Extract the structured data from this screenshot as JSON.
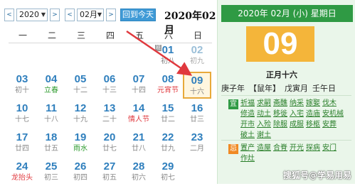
{
  "toolbar": {
    "year": "2020",
    "month": "02月",
    "prev": "<",
    "next": ">",
    "dropdown": "▼",
    "today_label": "回到今天"
  },
  "title": "2020年02月",
  "weekdays": [
    "一",
    "二",
    "三",
    "四",
    "五",
    "六",
    "日"
  ],
  "weeks": [
    [
      {
        "d": "",
        "l": ""
      },
      {
        "d": "",
        "l": ""
      },
      {
        "d": "",
        "l": ""
      },
      {
        "d": "",
        "l": ""
      },
      {
        "d": "",
        "l": ""
      },
      {
        "d": "01",
        "l": "初八",
        "ban": "班"
      },
      {
        "d": "02",
        "l": "初九",
        "dim": true
      }
    ],
    [
      {
        "d": "03",
        "l": "初十"
      },
      {
        "d": "04",
        "l": "立春",
        "c": "green"
      },
      {
        "d": "05",
        "l": "十二"
      },
      {
        "d": "06",
        "l": "十三"
      },
      {
        "d": "07",
        "l": "十四"
      },
      {
        "d": "08",
        "l": "元宵节",
        "c": "red"
      },
      {
        "d": "09",
        "l": "十六",
        "selected": true
      }
    ],
    [
      {
        "d": "10",
        "l": "十七"
      },
      {
        "d": "11",
        "l": "十八"
      },
      {
        "d": "12",
        "l": "十九"
      },
      {
        "d": "13",
        "l": "二十"
      },
      {
        "d": "14",
        "l": "情人节",
        "c": "red"
      },
      {
        "d": "15",
        "l": "廿二"
      },
      {
        "d": "16",
        "l": "廿三"
      }
    ],
    [
      {
        "d": "17",
        "l": "廿四"
      },
      {
        "d": "18",
        "l": "廿五"
      },
      {
        "d": "19",
        "l": "雨水",
        "c": "green"
      },
      {
        "d": "20",
        "l": "廿七"
      },
      {
        "d": "21",
        "l": "廿八"
      },
      {
        "d": "22",
        "l": "廿九"
      },
      {
        "d": "23",
        "l": "二月"
      }
    ],
    [
      {
        "d": "24",
        "l": "龙抬头",
        "c": "red"
      },
      {
        "d": "25",
        "l": "初三"
      },
      {
        "d": "26",
        "l": "初四"
      },
      {
        "d": "27",
        "l": "初五"
      },
      {
        "d": "28",
        "l": "初六"
      },
      {
        "d": "29",
        "l": "初七"
      },
      {
        "d": "",
        "l": ""
      }
    ]
  ],
  "panel": {
    "header": "2020年 02月 (小) 星期日",
    "day": "09",
    "lunar": "正月十六",
    "ganzhi": [
      "庚子年",
      "【鼠年】",
      "戊寅月",
      "壬午日"
    ],
    "yi_badge": "宜",
    "yi": [
      "祈福",
      "求嗣",
      "斋醮",
      "纳采",
      "嫁娶",
      "伐木",
      "修造",
      "动土",
      "移徙",
      "入宅",
      "造庙",
      "安机械",
      "开市",
      "入殓",
      "除服",
      "成服",
      "移柩",
      "安葬",
      "破土",
      "谢土"
    ],
    "ji_badge": "忌",
    "ji": [
      "置产",
      "造屋",
      "合脊",
      "开光",
      "探病",
      "安门",
      "作灶"
    ]
  },
  "watermark": "搜狐号@学易用易",
  "colors": {
    "accent": "#2f7fbd",
    "panel_head": "#2f9a44",
    "day_box": "#f4b53a",
    "holiday": "#e0393e",
    "solar_term": "#2e9b2e",
    "arrow": "#e0393e"
  }
}
